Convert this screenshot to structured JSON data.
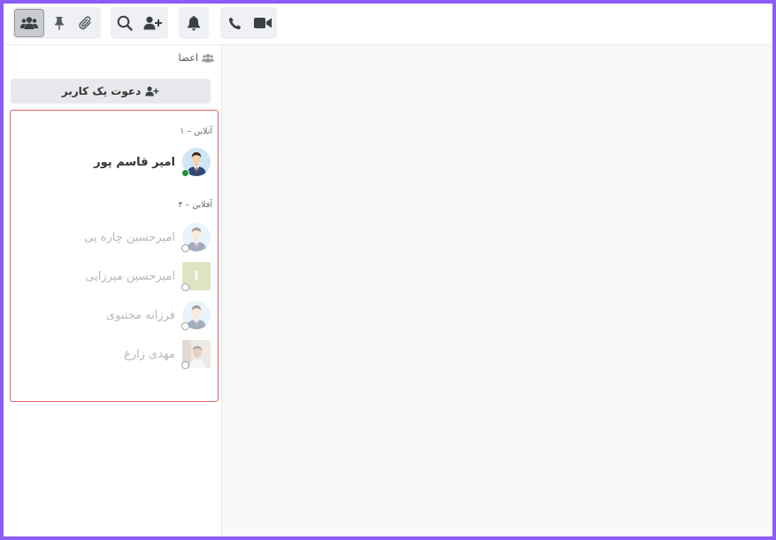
{
  "toolbar": {
    "groups": [
      {
        "buttons": [
          "members-icon",
          "pin-icon",
          "paperclip-icon"
        ],
        "active": "members-icon"
      },
      {
        "buttons": [
          "search-icon",
          "add-user-icon"
        ]
      },
      {
        "buttons": [
          "bell-icon"
        ]
      },
      {
        "buttons": [
          "phone-icon",
          "video-icon"
        ]
      }
    ]
  },
  "sidebar": {
    "header_label": "اعضا",
    "invite_label": "دعوت یک کاربر",
    "online_label": "آنلاین – ۱",
    "offline_label": "آفلاین – ۴",
    "online_members": [
      {
        "name": "امیر قاسم پور",
        "avatar": "man-suit-avatar",
        "status": "online"
      }
    ],
    "offline_members": [
      {
        "name": "امیرحسین چاره یی",
        "avatar": "man-suit-avatar",
        "status": "offline"
      },
      {
        "name": "امیرحسین میرزایی",
        "avatar": "letter-avatar",
        "avatar_letter": "ا",
        "avatar_color": "#b5c47a",
        "status": "offline"
      },
      {
        "name": "فرزانه مجتبوی",
        "avatar": "man-suit-avatar",
        "status": "offline"
      },
      {
        "name": "مهدی زارع",
        "avatar": "photo-avatar",
        "status": "offline"
      }
    ]
  },
  "colors": {
    "frame": "#8b5cf6",
    "highlight_border": "#e06666",
    "online": "#1f8f3a"
  }
}
